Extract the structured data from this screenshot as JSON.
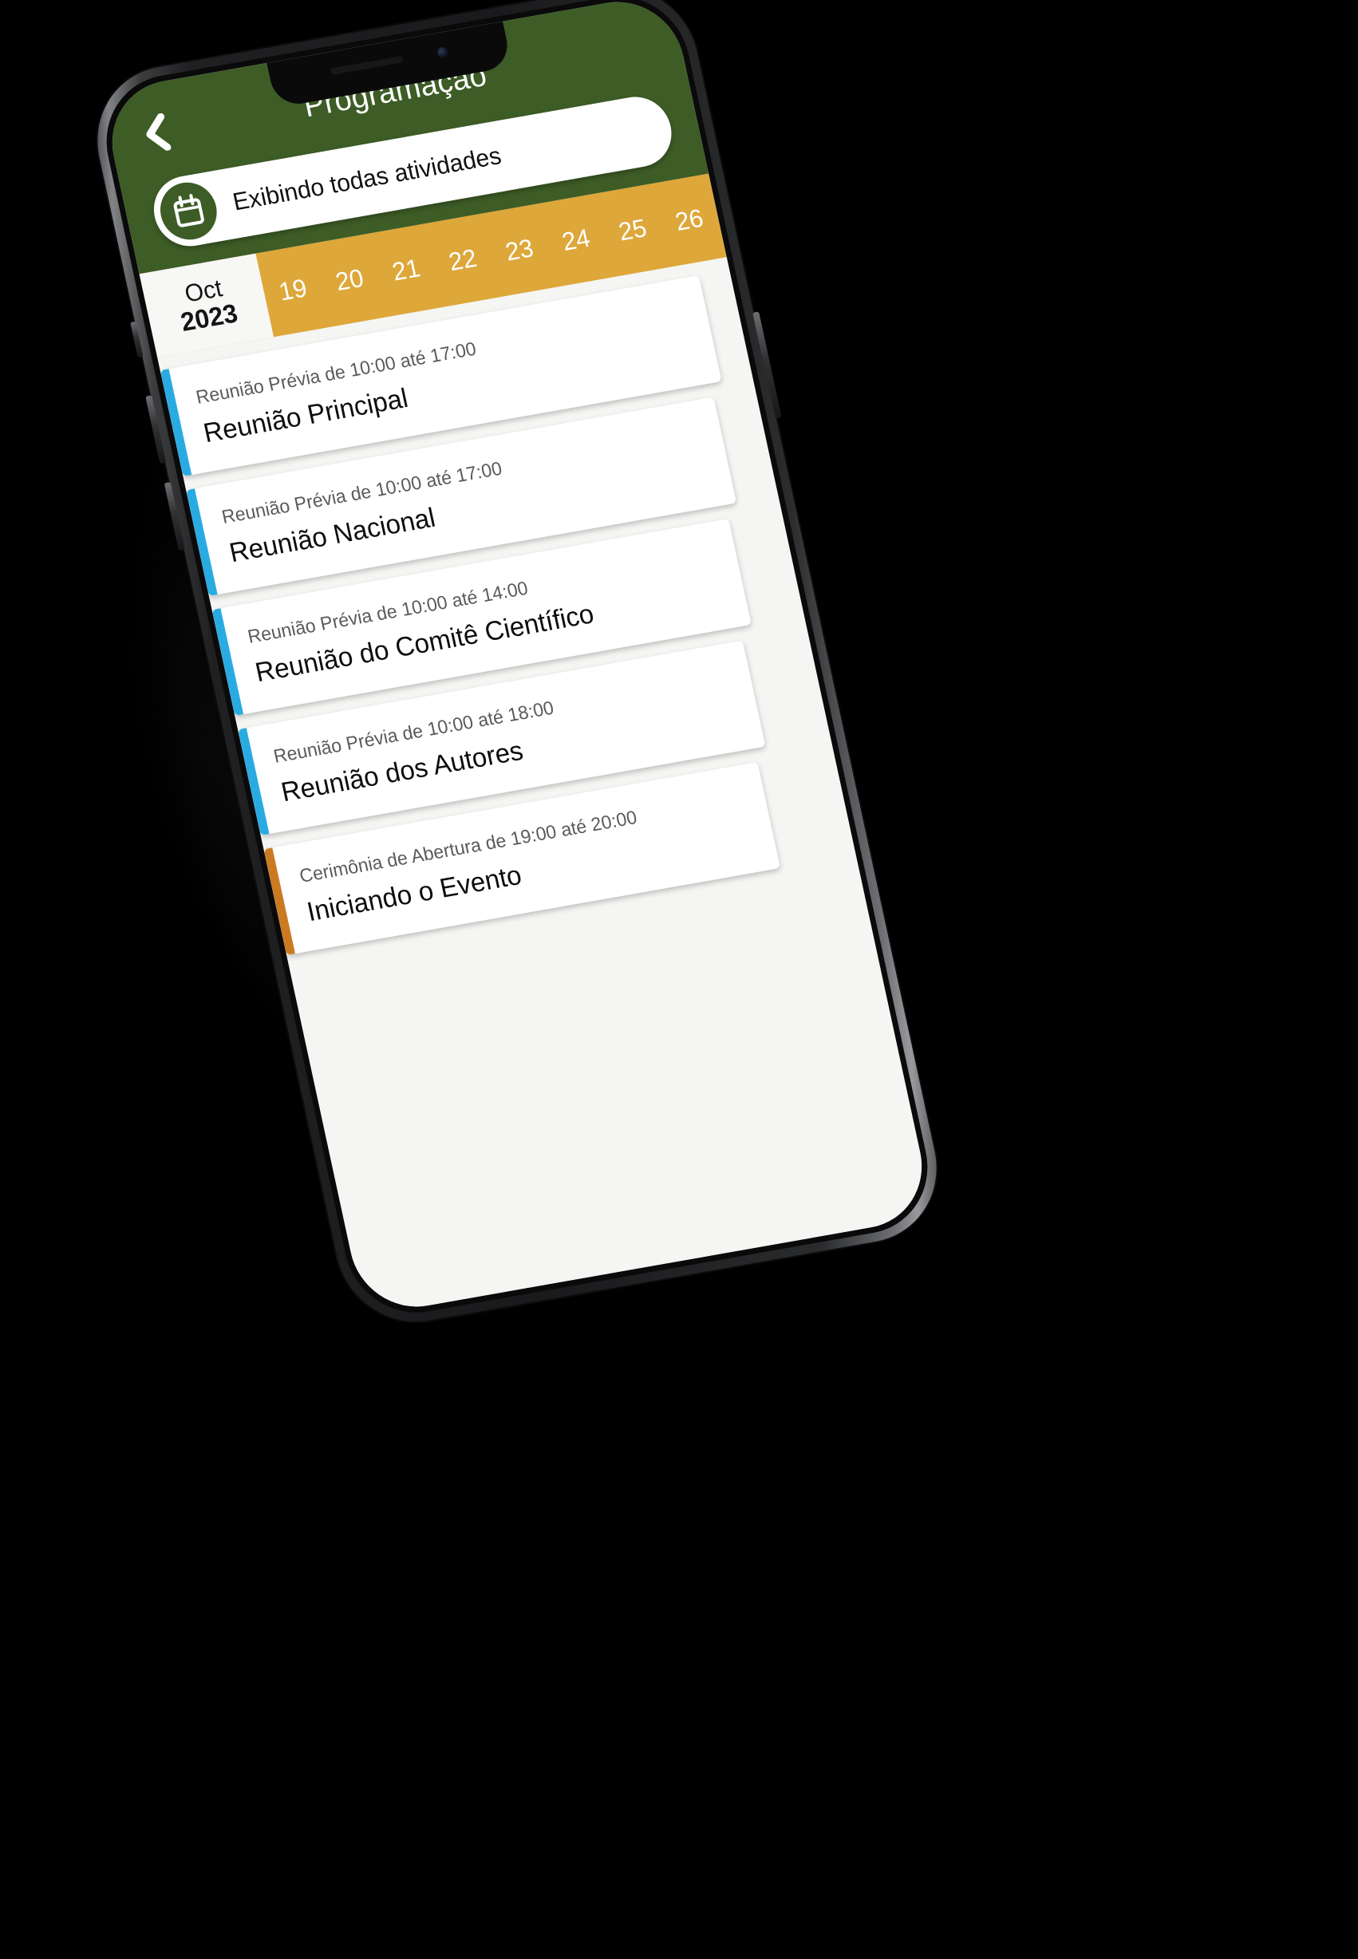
{
  "app": {
    "header": {
      "title": "Programação",
      "back_icon": "chevron-left-icon",
      "bg_color": "#3d5c26"
    },
    "filter": {
      "icon": "calendar-icon",
      "label": "Exibindo todas atividades"
    },
    "date_strip": {
      "month": "Oct",
      "year": "2023",
      "bg_color": "#dda73a",
      "days": [
        "19",
        "20",
        "21",
        "22",
        "23",
        "24",
        "25",
        "26"
      ]
    },
    "activities": [
      {
        "meta": "Reunião Prévia de 10:00 até 17:00",
        "title": "Reunião Principal",
        "accent": "#29abe2"
      },
      {
        "meta": "Reunião Prévia de 10:00 até 17:00",
        "title": "Reunião Nacional",
        "accent": "#29abe2"
      },
      {
        "meta": "Reunião Prévia de 10:00 até 14:00",
        "title": "Reunião do Comitê Científico",
        "accent": "#29abe2"
      },
      {
        "meta": "Reunião Prévia de 10:00 até 18:00",
        "title": "Reunião dos Autores",
        "accent": "#29abe2"
      },
      {
        "meta": "Cerimônia de Abertura de 19:00 até 20:00",
        "title": "Iniciando o Evento",
        "accent": "#cc7a22"
      }
    ]
  }
}
